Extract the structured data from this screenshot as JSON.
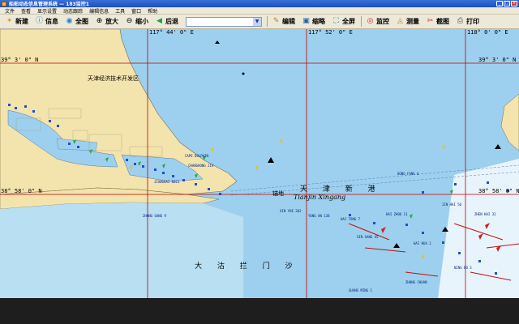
{
  "window": {
    "title": "船舶动态信息管理系统 — 183监控1"
  },
  "menu": [
    "文件",
    "查看",
    "显示设置",
    "动态跟踪",
    "编辑信息",
    "工具",
    "窗口",
    "帮助"
  ],
  "toolbar": {
    "left_buttons": [
      {
        "label": "新建",
        "icon": "new-icon",
        "color": "#e0a020"
      },
      {
        "label": "信息",
        "icon": "info-icon",
        "color": "#3070c0"
      },
      {
        "label": "全图",
        "icon": "globe-icon",
        "color": "#2a80c8"
      },
      {
        "label": "放大",
        "icon": "zoom-in-icon",
        "color": "#404040"
      },
      {
        "label": "缩小",
        "icon": "zoom-out-icon",
        "color": "#404040"
      },
      {
        "label": "后退",
        "icon": "back-icon",
        "color": "#20a040"
      }
    ],
    "right_buttons": [
      {
        "label": "编辑",
        "icon": "edit-icon",
        "color": "#c08020"
      },
      {
        "label": "缩略",
        "icon": "thumbnail-icon",
        "color": "#2060b0"
      },
      {
        "label": "全屏",
        "icon": "fullscreen-icon",
        "color": "#2060b0"
      },
      {
        "label": "监控",
        "icon": "monitor-icon",
        "color": "#c03030"
      },
      {
        "label": "测量",
        "icon": "measure-icon",
        "color": "#c08020"
      },
      {
        "label": "截图",
        "icon": "screenshot-icon",
        "color": "#c03030"
      },
      {
        "label": "打印",
        "icon": "print-icon",
        "color": "#505050"
      }
    ],
    "select_value": ""
  },
  "map": {
    "coords": {
      "top_lon_1": "117° 44' 0\" E",
      "top_lon_2": "117° 52' 0\" E",
      "top_lon_3": "118° 0' 0\" E",
      "lat_top_left": "39° 3' 0\" N",
      "lat_top_right": "39° 3' 0\" N",
      "lat_mid_left": "38° 58' 0\" N",
      "lat_mid_right": "38° 58' 0\" N"
    },
    "places": {
      "economic_zone": "天津经济技术开发区",
      "tianjin_xingang_cn": "天 津 新 港",
      "tianjin_xingang_en": "Tianjin Xingang",
      "dagu_sandbar": "大 沽 拦 门 沙",
      "anchorage": "锚地"
    },
    "colors": {
      "sea": "#9dd0ee",
      "land": "#f3e4ae",
      "gridline": "#c00000"
    },
    "ship_labels": [
      "CAPE DOLPHIN",
      "CHANGHONG JIA",
      "JIANGHAI 0021",
      "ZHONG GANG 9",
      "DONG FANG 6",
      "XIN YUE 202",
      "HAI TONG 7",
      "HAI ZHOU 11",
      "YONG AN 138",
      "XIN GANG 45",
      "HAI HUA 2",
      "JIN HAI 56",
      "ZHEN HAI 32",
      "NING BO 3",
      "ZHONG CHUAN",
      "GUANG MING 1"
    ]
  }
}
